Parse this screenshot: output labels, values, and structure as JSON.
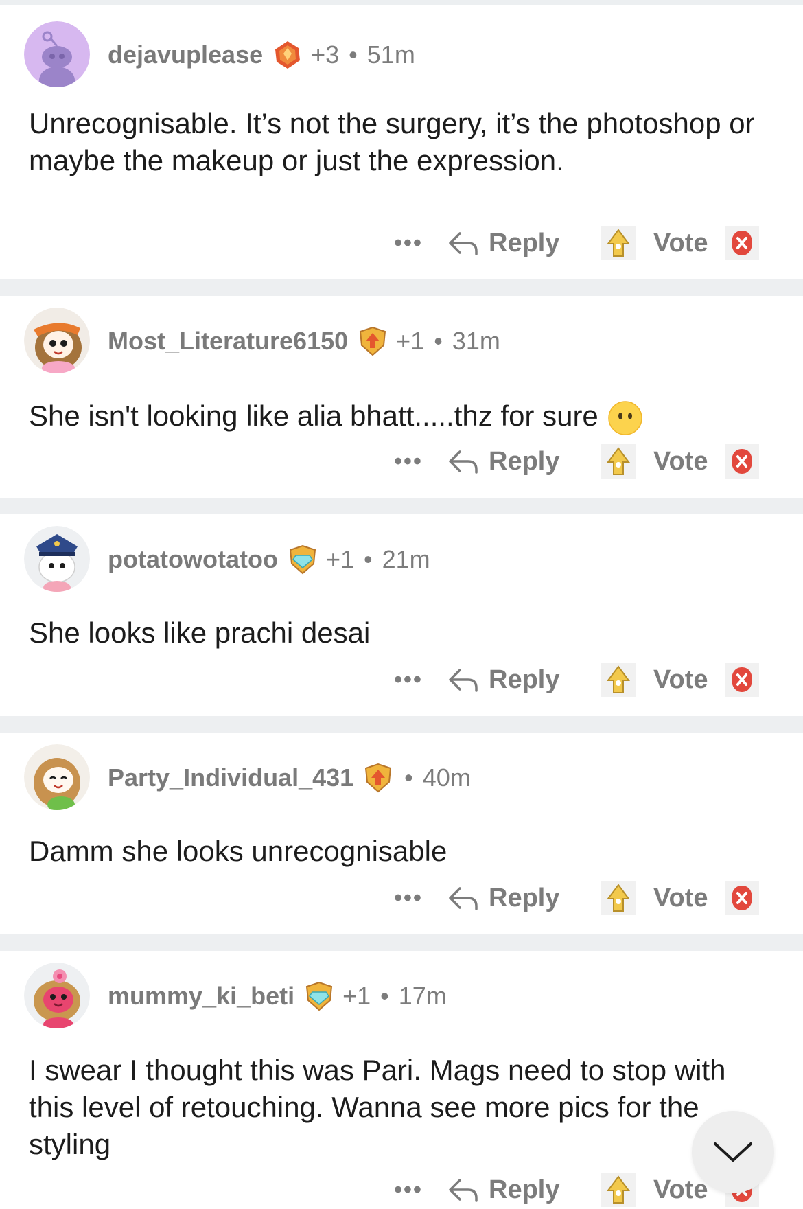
{
  "comments": [
    {
      "username": "dejavuplease",
      "score": "+3",
      "separator": "•",
      "time": "51m",
      "avatar_icon": "snoo-avatar-purple",
      "flair_icon": "gem-award-icon",
      "text": "Unrecognisable. It’s not the surgery, it’s the photoshop or maybe the makeup or just the expression."
    },
    {
      "username": "Most_Literature6150",
      "score": "+1",
      "separator": "•",
      "time": "31m",
      "avatar_icon": "snoo-avatar-bandana",
      "flair_icon": "upvote-shield-award-icon",
      "text": "She isn't looking like alia bhatt.....thz for sure",
      "emoji": "face-without-mouth-emoji"
    },
    {
      "username": "potatowotatoo",
      "score": "+1",
      "separator": "•",
      "time": "21m",
      "avatar_icon": "snoo-avatar-captain",
      "flair_icon": "diamond-shield-award-icon",
      "text": "She looks like prachi desai"
    },
    {
      "username": "Party_Individual_431",
      "score": "",
      "separator": "•",
      "time": "40m",
      "avatar_icon": "snoo-avatar-blonde",
      "flair_icon": "upvote-shield-award-icon",
      "text": "Damm she looks unrecognisable"
    },
    {
      "username": "mummy_ki_beti",
      "score": "+1",
      "separator": "•",
      "time": "17m",
      "avatar_icon": "snoo-avatar-pink-flower",
      "flair_icon": "diamond-shield-award-icon",
      "text": "I swear I thought this was Pari. Mags need to stop with this level of retouching.  Wanna see more pics for the styling"
    }
  ],
  "actions": {
    "more": "•••",
    "reply": "Reply",
    "vote": "Vote"
  },
  "colors": {
    "meta_gray": "#7c7c7c",
    "divider": "#edeff1",
    "downvote_red": "#e2483d",
    "upvote_gold": "#f2c94c"
  },
  "scroll_icon": "chevron-down-icon"
}
